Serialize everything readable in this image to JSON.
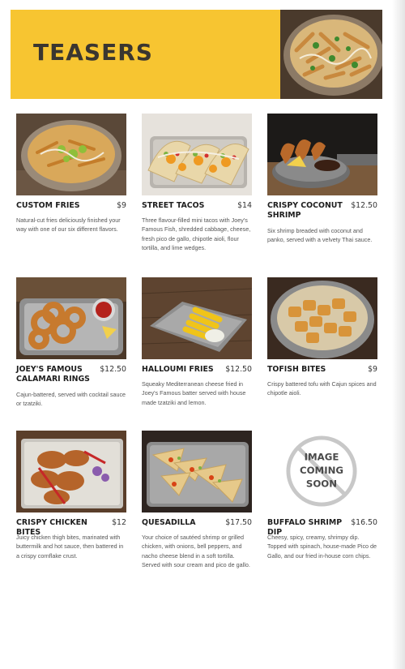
{
  "section": {
    "title": "TEASERS"
  },
  "placeholder": {
    "line1": "IMAGE",
    "line2": "COMING",
    "line3": "SOON"
  },
  "items": [
    {
      "name": "CUSTOM FRIES",
      "price": "$9",
      "desc": "Natural-cut fries deliciously finished your way with one of our six different flavors."
    },
    {
      "name": "STREET TACOS",
      "price": "$14",
      "desc": "Three flavour-filled mini tacos with Joey's Famous Fish, shredded cabbage, cheese, fresh pico de gallo, chipotle aioli, flour tortilla, and lime wedges."
    },
    {
      "name": "CRISPY COCONUT SHRIMP",
      "price": "$12.50",
      "desc": "Six shrimp breaded with coconut and panko, served with a velvety Thai sauce."
    },
    {
      "name": "JOEY'S FAMOUS CALAMARI RINGS",
      "price": "$12.50",
      "desc": "Cajun-battered, served with cocktail sauce or tzatziki."
    },
    {
      "name": "HALLOUMI FRIES",
      "price": "$12.50",
      "desc": "Squeaky Mediterranean cheese fried in Joey's Famous batter served with house made tzatziki and lemon."
    },
    {
      "name": "TOFISH BITES",
      "price": "$9",
      "desc": "Crispy battered tofu with Cajun spices and chipotle aioli."
    },
    {
      "name": "CRISPY CHICKEN BITES",
      "price": "$12",
      "desc": "Juicy chicken thigh bites, marinated with buttermilk and hot sauce, then battered in a crispy cornflake crust."
    },
    {
      "name": "QUESADILLA",
      "price": "$17.50",
      "desc": "Your choice of sautéed shrimp or grilled chicken, with onions, bell peppers, and nacho cheese blend in a soft tortilla. Served with sour cream and pico de gallo."
    },
    {
      "name": "BUFFALO SHRIMP DIP",
      "price": "$16.50",
      "desc": "Cheesy, spicy, creamy, shrimpy dip. Topped with spinach, house-made Pico de Gallo, and our fried in-house corn chips."
    }
  ]
}
